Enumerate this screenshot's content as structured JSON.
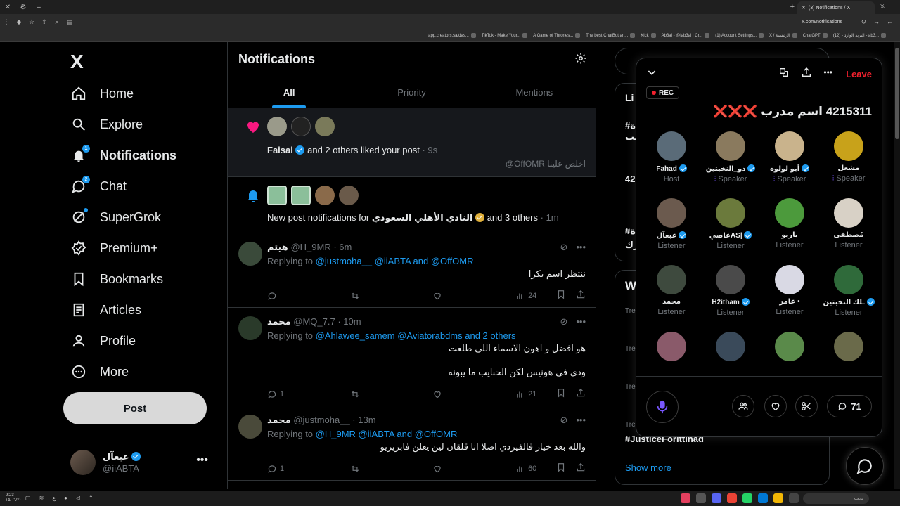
{
  "browser": {
    "tab_title": "(3) Notifications / X",
    "url": "x.com/notifications",
    "bookmarks": [
      "app.creators.sa/das...",
      "TikTok - Make Your...",
      "A Game of Thrones...",
      "The best ChatBot an...",
      "Kick",
      "Ab3al - @iab3al | Cr...",
      "(1) Account Settings...",
      "X / الرئيسية",
      "ChatGPT",
      "(12) - البريد الوارد - ab3..."
    ]
  },
  "nav": {
    "logo": "X",
    "items": [
      {
        "label": "Home",
        "badge": ""
      },
      {
        "label": "Explore",
        "badge": ""
      },
      {
        "label": "Notifications",
        "badge": "1"
      },
      {
        "label": "Chat",
        "badge": "2"
      },
      {
        "label": "SuperGrok",
        "badge": ""
      },
      {
        "label": "Premium+",
        "badge": ""
      },
      {
        "label": "Bookmarks",
        "badge": ""
      },
      {
        "label": "Articles",
        "badge": ""
      },
      {
        "label": "Profile",
        "badge": ""
      },
      {
        "label": "More",
        "badge": ""
      }
    ],
    "post_label": "Post",
    "account": {
      "name": "عبعآل",
      "handle": "@iiABTA"
    }
  },
  "main": {
    "title": "Notifications",
    "tabs": [
      "All",
      "Priority",
      "Mentions"
    ],
    "like_notif": {
      "name": "Faisal",
      "text": "and 2 others liked your post",
      "time": "· 9s",
      "quote": "@OffOMR اخلص علينا"
    },
    "post_notif": {
      "prefix": "New post notifications for",
      "name": "النادي الأهلي السعودي",
      "suffix": "and 3 others",
      "time": "· 1m"
    },
    "replies": [
      {
        "name": "هيثم",
        "handle": "@H_9MR · 6m",
        "replying_prefix": "Replying to",
        "replying_to": "@justmoha__ @iiABTA and @OffOMR",
        "lines": [
          "ننتظر اسم بكرا"
        ],
        "stats": {
          "replies": "",
          "reposts": "",
          "likes": "",
          "views": "24"
        }
      },
      {
        "name": "محمد",
        "handle": "@MQ_7.7 · 10m",
        "replying_prefix": "Replying to",
        "replying_to": "@Ahlawee_samem @Aviatorabdms and 2 others",
        "lines": [
          "هو افضل و اهون الاسماء اللي طلعت",
          "ودي في هونيس لكن الحبايب ما يبونه"
        ],
        "stats": {
          "replies": "1",
          "reposts": "",
          "likes": "",
          "views": "21"
        }
      },
      {
        "name": "محمد",
        "handle": "@justmoha__ · 13m",
        "replying_prefix": "Replying to",
        "replying_to": "@H_9MR @iiABTA and @OffOMR",
        "lines": [
          "والله بعد خيار فالفيردي اصلا انا قلقان لين يعلن فابريزيو"
        ],
        "stats": {
          "replies": "1",
          "reposts": "",
          "likes": "",
          "views": "60"
        }
      }
    ]
  },
  "right": {
    "peek_live": "Li",
    "peek_hash1": "#ة",
    "peek_hash1b": "لب",
    "peek_num": "42",
    "peek_hash2": "#ة",
    "peek_hash2b": "رك",
    "peek_what": "W",
    "trend_label": "Tre",
    "hashtag": "#JusticeForIttihad",
    "show_more": "Show more"
  },
  "space": {
    "rec": "REC",
    "leave": "Leave",
    "title_num": "4215311",
    "title_text": "اسم مدرب",
    "title_x": "❌❌❌",
    "participants": [
      {
        "name": "Fahad",
        "role": "Host",
        "verified": true,
        "color": "#5a6b78"
      },
      {
        "name": "ذو_النخبتين",
        "role": "Speaker",
        "verified": true,
        "color": "#8a7a5e"
      },
      {
        "name": "أبو لولوة",
        "role": "Speaker",
        "verified": true,
        "color": "#c9b38c"
      },
      {
        "name": "مشعل",
        "role": "Speaker",
        "verified": false,
        "color": "#c8a21a"
      },
      {
        "name": "عبعآل",
        "role": "Listener",
        "verified": true,
        "color": "#6b5a4e"
      },
      {
        "name": "عاصيAS|",
        "role": "Listener",
        "verified": true,
        "color": "#6b7a3c"
      },
      {
        "name": "باريو",
        "role": "Listener",
        "verified": false,
        "color": "#4c9a3c"
      },
      {
        "name": "مُصطفى",
        "role": "Listener",
        "verified": false,
        "color": "#d8d1c6"
      },
      {
        "name": "محمد",
        "role": "Listener",
        "verified": false,
        "color": "#3e4a3e"
      },
      {
        "name": "H2itham",
        "role": "Listener",
        "verified": true,
        "color": "#4a4a4a"
      },
      {
        "name": "عامر •",
        "role": "Listener",
        "verified": false,
        "color": "#d9d9e4"
      },
      {
        "name": "ـلك النخبتين",
        "role": "Listener",
        "verified": true,
        "color": "#2f6a3a"
      },
      {
        "name": "",
        "role": "",
        "verified": false,
        "color": "#8a5a6a"
      },
      {
        "name": "",
        "role": "",
        "verified": false,
        "color": "#3a4a5a"
      },
      {
        "name": "",
        "role": "",
        "verified": false,
        "color": "#5a8a4a"
      },
      {
        "name": "",
        "role": "",
        "verified": false,
        "color": "#6a6a4a"
      }
    ],
    "comment_count": "71"
  },
  "taskbar": {
    "clock_time": "9:23",
    "clock_date": "١٥/٠٦/٢٠",
    "search": "بحث"
  },
  "colors": {
    "accent": "#1d9bf0",
    "like": "#f91880",
    "leave": "#f4212e",
    "gold": "#e0b03b"
  }
}
